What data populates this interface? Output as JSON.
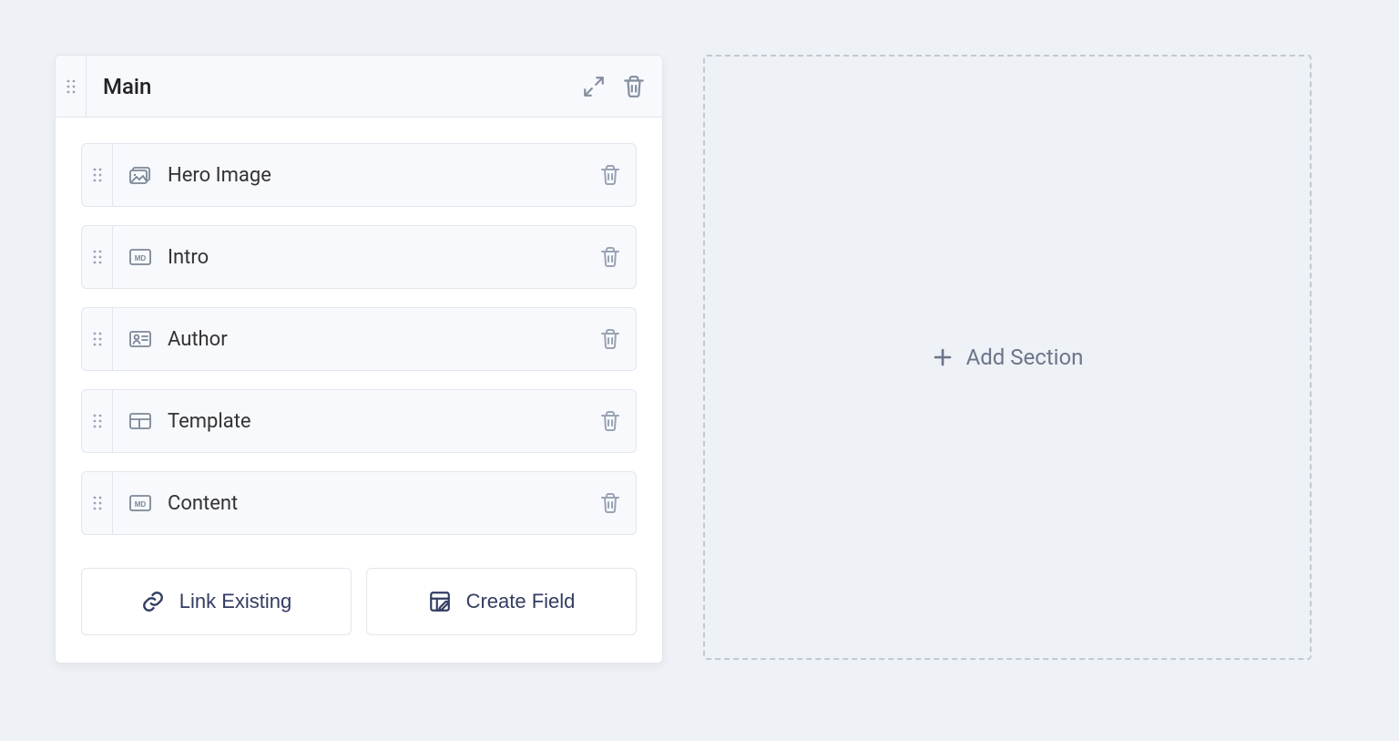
{
  "section": {
    "title": "Main",
    "fields": [
      {
        "label": "Hero Image",
        "type": "image"
      },
      {
        "label": "Intro",
        "type": "markdown"
      },
      {
        "label": "Author",
        "type": "reference"
      },
      {
        "label": "Template",
        "type": "component"
      },
      {
        "label": "Content",
        "type": "markdown"
      }
    ],
    "actions": {
      "link_existing_label": "Link Existing",
      "create_field_label": "Create Field"
    }
  },
  "placeholder": {
    "add_section_label": "Add Section"
  }
}
